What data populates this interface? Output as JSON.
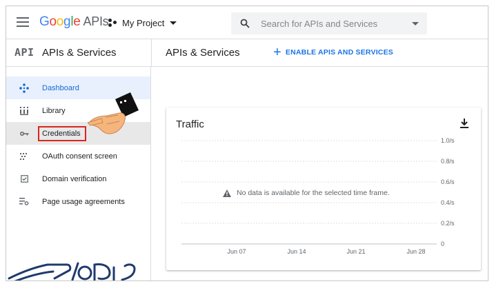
{
  "topbar": {
    "logo_letters": [
      "G",
      "o",
      "o",
      "g",
      "l",
      "e"
    ],
    "logo_apis": "APIs",
    "project_name": "My Project",
    "search_placeholder": "Search for APIs and Services"
  },
  "subheader": {
    "api_badge": "API",
    "left_title": "APIs & Services",
    "main_title": "APIs & Services",
    "enable_plus": "+",
    "enable_label": "ENABLE APIS AND SERVICES"
  },
  "sidebar": {
    "items": [
      {
        "label": "Dashboard",
        "icon": "dashboard-icon",
        "state": "active"
      },
      {
        "label": "Library",
        "icon": "library-icon",
        "state": ""
      },
      {
        "label": "Credentials",
        "icon": "key-icon",
        "state": "selected"
      },
      {
        "label": "OAuth consent screen",
        "icon": "oauth-consent-icon",
        "state": ""
      },
      {
        "label": "Domain verification",
        "icon": "domain-check-icon",
        "state": ""
      },
      {
        "label": "Page usage agreements",
        "icon": "settings-list-icon",
        "state": ""
      }
    ]
  },
  "traffic": {
    "title": "Traffic",
    "no_data_message": "No data is available for the selected time frame."
  },
  "chart_data": {
    "type": "line",
    "title": "Traffic",
    "x": [
      "Jun 07",
      "Jun 14",
      "Jun 21",
      "Jun 28"
    ],
    "y_ticks": [
      "1.0/s",
      "0.8/s",
      "0.6/s",
      "0.4/s",
      "0.2/s",
      "0"
    ],
    "ylim": [
      0,
      1.0
    ],
    "series": [],
    "grid": true
  },
  "colors": {
    "accent": "#1a73e8",
    "active_bg": "#e8f0fe",
    "highlight_border": "#d9251d"
  }
}
